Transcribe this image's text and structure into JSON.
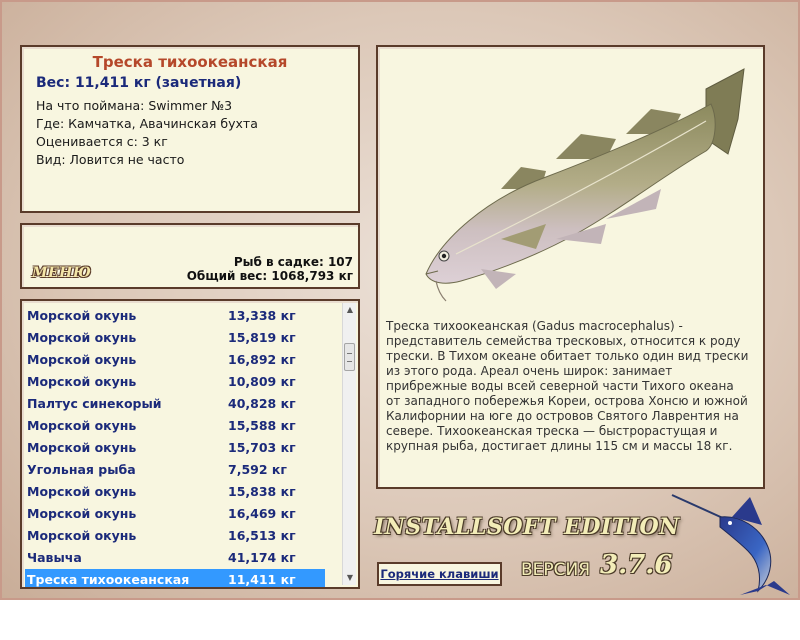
{
  "info": {
    "name": "Треска тихоокеанская",
    "weight": "Вес: 11,411 кг (зачетная)",
    "lines": [
      "На что поймана: Swimmer №3",
      "Где: Камчатка, Авачинская бухта",
      "Оценивается с: 3 кг",
      "Вид: Ловится не часто"
    ]
  },
  "stats": {
    "menu_label": "МЕНЮ",
    "fish_count": "Рыб в садке: 107",
    "total_weight": "Общий вес: 1068,793 кг"
  },
  "catch_list": [
    {
      "name": "Морской окунь",
      "weight": "13,338 кг"
    },
    {
      "name": "Морской окунь",
      "weight": "15,819 кг"
    },
    {
      "name": "Морской окунь",
      "weight": "16,892 кг"
    },
    {
      "name": "Морской окунь",
      "weight": "10,809 кг"
    },
    {
      "name": "Палтус синекорый",
      "weight": "40,828 кг"
    },
    {
      "name": "Морской окунь",
      "weight": "15,588 кг"
    },
    {
      "name": "Морской окунь",
      "weight": "15,703 кг"
    },
    {
      "name": "Угольная рыба",
      "weight": "7,592 кг"
    },
    {
      "name": "Морской окунь",
      "weight": "15,838 кг"
    },
    {
      "name": "Морской окунь",
      "weight": "16,469 кг"
    },
    {
      "name": "Морской окунь",
      "weight": "16,513 кг"
    },
    {
      "name": "Чавыча",
      "weight": "41,174 кг"
    },
    {
      "name": "Треска тихоокеанская",
      "weight": "11,411 кг",
      "selected": true
    }
  ],
  "description": "Треска тихоокеанская (Gadus macrocephalus) - представитель семейства тресковых, относится к роду трески. В Тихом океане обитает только один вид трески из этого рода. Ареал очень широк: занимает прибрежные воды всей северной части Тихого океана от западного побережья Кореи, острова Хонсю и южной Калифорнии на юге до островов Святого Лаврентия на севере. Тихоокеанская треска — быстрорастущая и крупная рыба, достигает длины 115 см и массы 18 кг.",
  "branding": {
    "edition": "INSTALLSOFT EDITION",
    "version_label": "ВЕРСИЯ",
    "version_number": "3.7.6"
  },
  "hotkeys_label": "Горячие клавиши",
  "colors": {
    "panel_bg": "#f8f6e0",
    "panel_border": "#5a3b2a",
    "fish_name": "#b5482a",
    "list_text": "#1b2a7a",
    "selection": "#3399ff"
  },
  "icons": {
    "fish_image": "pacific-cod-image",
    "marlin": "marlin-logo-icon"
  }
}
